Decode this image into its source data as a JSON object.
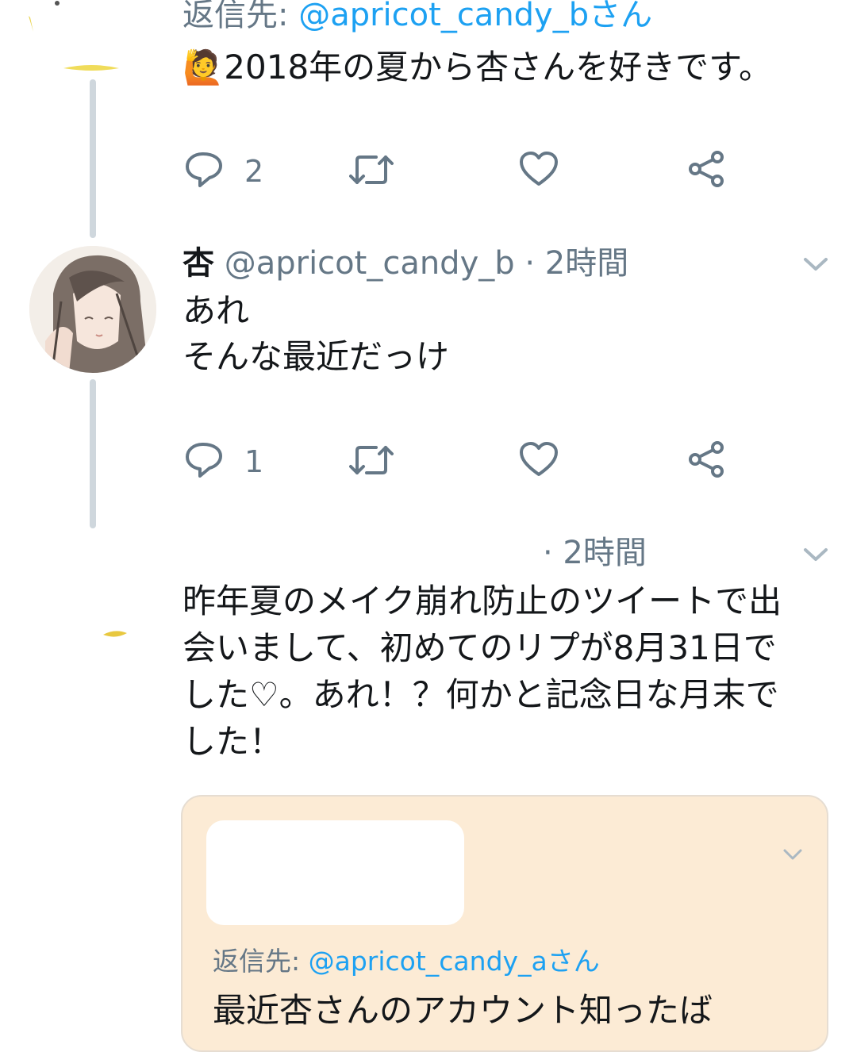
{
  "tweet1": {
    "reply_prefix": "返信先: ",
    "reply_handle": "@apricot_candy_bさん",
    "emoji": "🙋",
    "text": "2018年の夏から杏さんを好きです。",
    "reply_count": "2"
  },
  "tweet2": {
    "name": "杏",
    "handle_time": "@apricot_candy_b · 2時間",
    "line1": "あれ",
    "line2": "そんな最近だっけ",
    "reply_count": "1"
  },
  "tweet3": {
    "time": "· 2時間",
    "line1": "昨年夏のメイク崩れ防止のツイートで出",
    "line2": "会いまして、初めてのリプが8月31日で",
    "line3": "した♡。あれ！？何かと記念日な月末で",
    "line4": "した！"
  },
  "quote": {
    "reply_prefix": "返信先: ",
    "reply_handle": "@apricot_candy_aさん",
    "text": "最近杏さんのアカウント知ったば"
  },
  "colors": {
    "accent": "#1da1f2",
    "secondary_text": "#657786",
    "thread_line": "#cfd7dd",
    "quote_bg": "#fcebd5"
  },
  "icons": [
    "reply-icon",
    "retweet-icon",
    "like-icon",
    "share-icon",
    "chevron-down-icon"
  ]
}
